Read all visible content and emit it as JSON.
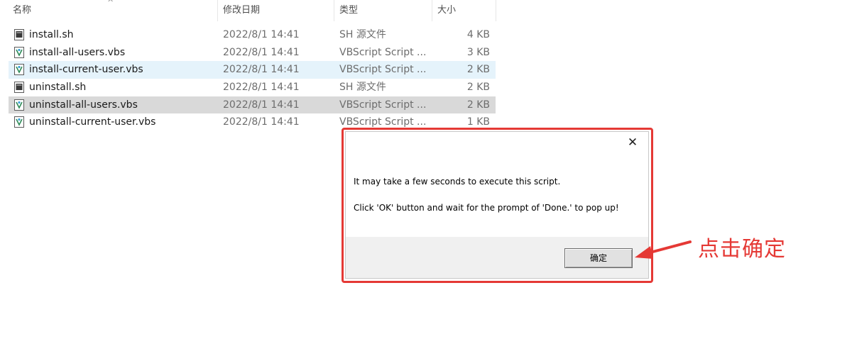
{
  "explorer": {
    "columns": {
      "name": "名称",
      "date": "修改日期",
      "type": "类型",
      "size": "大小"
    },
    "sort_indicator": "^",
    "files": [
      {
        "name": "install.sh",
        "date": "2022/8/1 14:41",
        "type": "SH 源文件",
        "size": "4 KB",
        "icon": "sh-file-icon"
      },
      {
        "name": "install-all-users.vbs",
        "date": "2022/8/1 14:41",
        "type": "VBScript Script ...",
        "size": "3 KB",
        "icon": "vbs-file-icon"
      },
      {
        "name": "install-current-user.vbs",
        "date": "2022/8/1 14:41",
        "type": "VBScript Script ...",
        "size": "2 KB",
        "icon": "vbs-file-icon"
      },
      {
        "name": "uninstall.sh",
        "date": "2022/8/1 14:41",
        "type": "SH 源文件",
        "size": "2 KB",
        "icon": "sh-file-icon"
      },
      {
        "name": "uninstall-all-users.vbs",
        "date": "2022/8/1 14:41",
        "type": "VBScript Script ...",
        "size": "2 KB",
        "icon": "vbs-file-icon"
      },
      {
        "name": "uninstall-current-user.vbs",
        "date": "2022/8/1 14:41",
        "type": "VBScript Script ...",
        "size": "1 KB",
        "icon": "vbs-file-icon"
      }
    ]
  },
  "dialog": {
    "close_label": "✕",
    "message_line1": "It may take a few seconds to execute this script.",
    "message_line2": "Click 'OK' button and wait for the prompt of 'Done.' to pop up!",
    "ok_label": "确定"
  },
  "annotation": {
    "text": "点击确定"
  },
  "colors": {
    "highlight_red": "#e53935",
    "row_hover": "#e5f3fb",
    "row_selected": "#d9d9d9",
    "dialog_footer": "#f0f0f0"
  }
}
